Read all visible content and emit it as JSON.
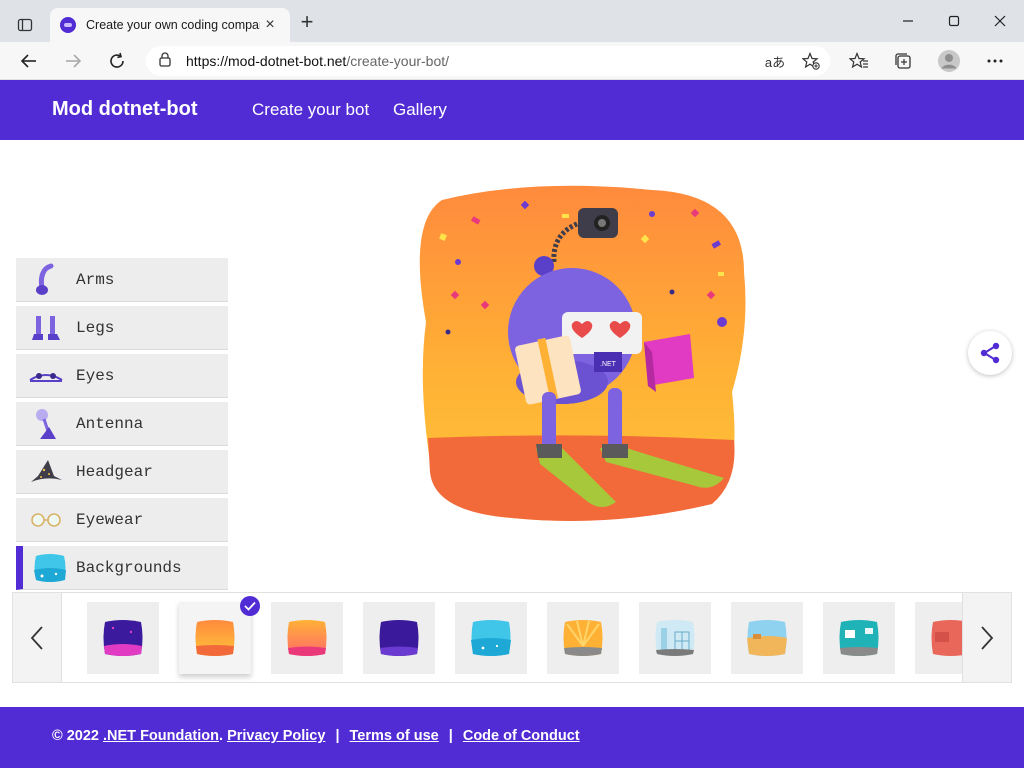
{
  "browser": {
    "tab_title": "Create your own coding compan",
    "tab_close": "×",
    "new_tab": "+",
    "url_host": "https://mod-dotnet-bot.net",
    "url_path": "/create-your-bot/",
    "read_aloud": "aあ",
    "icons": [
      "window-menu-icon",
      "back-icon",
      "forward-icon",
      "refresh-icon",
      "lock-icon",
      "read-aloud-icon",
      "add-favorite-icon",
      "favorites-icon",
      "collections-icon",
      "profile-icon",
      "more-icon",
      "minimize-icon",
      "maximize-icon",
      "close-icon"
    ]
  },
  "header": {
    "brand": "Mod dotnet-bot",
    "nav": [
      {
        "label": "Create your bot"
      },
      {
        "label": "Gallery"
      }
    ],
    "color": "#512bd4"
  },
  "sidebar": {
    "items": [
      {
        "label": "Arms"
      },
      {
        "label": "Legs"
      },
      {
        "label": "Eyes"
      },
      {
        "label": "Antenna"
      },
      {
        "label": "Headgear"
      },
      {
        "label": "Eyewear"
      },
      {
        "label": "Backgrounds",
        "active": true
      }
    ]
  },
  "carousel": {
    "prev": "‹",
    "next": "›",
    "selected_index": 1,
    "thumbs": [
      "space-purple",
      "sunset-orange",
      "peach-pink",
      "deep-indigo",
      "ocean-blue",
      "sunburst",
      "city-grid",
      "desert",
      "teal-room",
      "red-brick"
    ]
  },
  "footer": {
    "copyright": "© 2022",
    "foundation": ".NET Foundation",
    "period": ".",
    "privacy": "Privacy Policy",
    "terms": "Terms of use",
    "conduct": "Code of Conduct",
    "sep": "|"
  }
}
